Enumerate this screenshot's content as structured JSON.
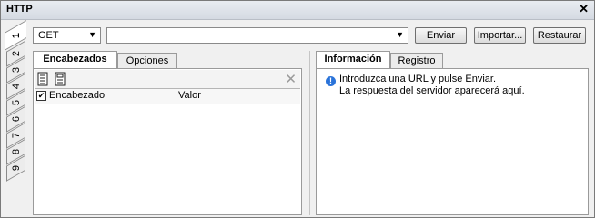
{
  "window": {
    "title": "HTTP"
  },
  "side_tabs": [
    "1",
    "2",
    "3",
    "4",
    "5",
    "6",
    "7",
    "8",
    "9"
  ],
  "toolbar": {
    "method": "GET",
    "url_value": "",
    "send_label": "Enviar",
    "import_label": "Importar...",
    "restore_label": "Restaurar"
  },
  "left_panel": {
    "tabs": [
      "Encabezados",
      "Opciones"
    ],
    "columns": [
      "Encabezado",
      "Valor"
    ]
  },
  "right_panel": {
    "tabs": [
      "Información",
      "Registro"
    ],
    "info_lines": [
      "Introduzca una URL y pulse Enviar.",
      "La respuesta del servidor aparecerá aquí."
    ]
  }
}
